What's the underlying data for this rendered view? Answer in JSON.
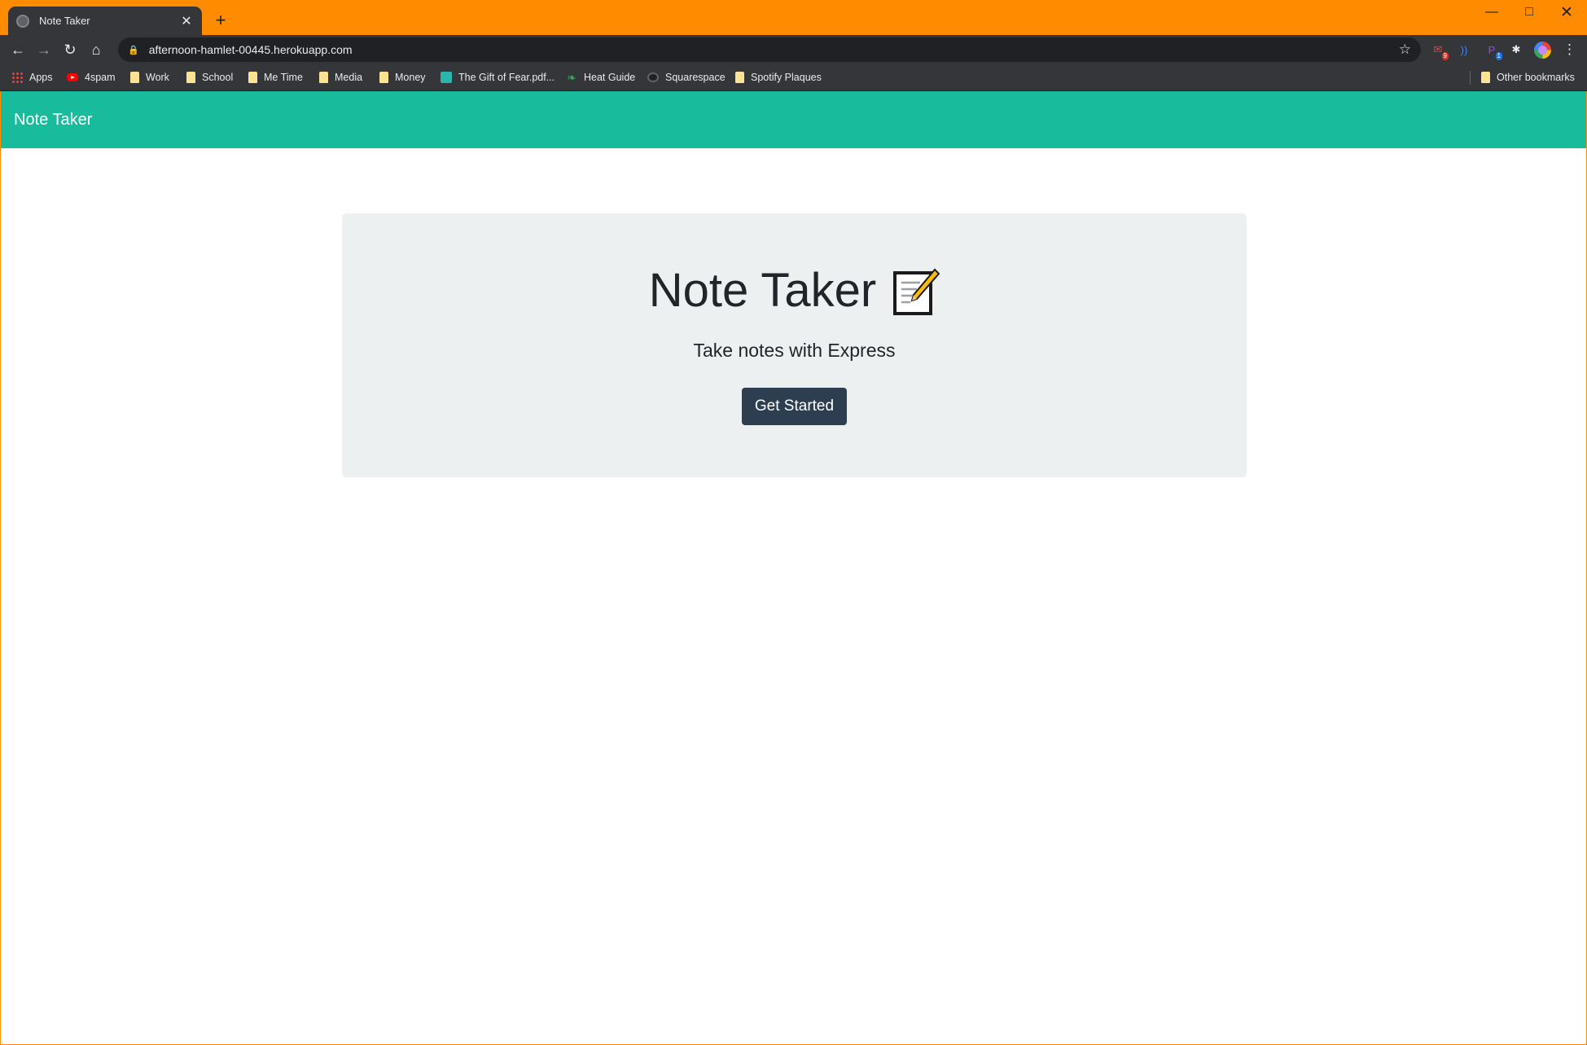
{
  "browser": {
    "tab_title": "Note Taker",
    "url": "afternoon-hamlet-00445.herokuapp.com",
    "bookmarks": [
      {
        "label": "Apps",
        "icon": "apps-grid-icon"
      },
      {
        "label": "4spam",
        "icon": "youtube-icon"
      },
      {
        "label": "Work",
        "icon": "folder-icon"
      },
      {
        "label": "School",
        "icon": "folder-icon"
      },
      {
        "label": "Me Time",
        "icon": "folder-icon"
      },
      {
        "label": "Media",
        "icon": "folder-icon"
      },
      {
        "label": "Money",
        "icon": "folder-icon"
      },
      {
        "label": "The Gift of Fear.pdf...",
        "icon": "document-icon"
      },
      {
        "label": "Heat Guide",
        "icon": "leaf-icon"
      },
      {
        "label": "Squarespace",
        "icon": "squarespace-icon"
      },
      {
        "label": "Spotify Plaques",
        "icon": "folder-icon"
      }
    ],
    "other_bookmarks": "Other bookmarks",
    "extension_badges": [
      "9",
      "1"
    ],
    "frame_color": "#ff8c00"
  },
  "page": {
    "navbar_brand": "Note Taker",
    "heading": "Note Taker",
    "heading_emoji": "memo-icon",
    "lead": "Take notes with Express",
    "cta_label": "Get Started",
    "colors": {
      "navbar": "#18bc9c",
      "jumbotron": "#ecf0f1",
      "button": "#2c3e50"
    }
  }
}
